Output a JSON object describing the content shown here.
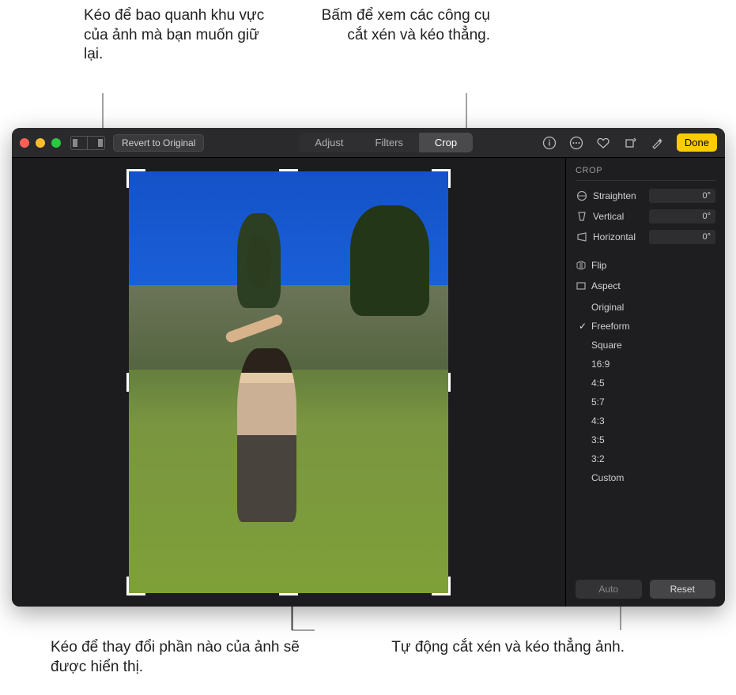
{
  "callouts": {
    "topLeft": "Kéo để bao quanh khu vực của ảnh mà bạn muốn giữ lại.",
    "topRight": "Bấm để xem các công cụ cắt xén và kéo thẳng.",
    "bottomLeft": "Kéo để thay đổi phần nào của ảnh sẽ được hiển thị.",
    "bottomRight": "Tự động cắt xén và kéo thẳng ảnh."
  },
  "toolbar": {
    "revert": "Revert to Original",
    "tabs": {
      "adjust": "Adjust",
      "filters": "Filters",
      "crop": "Crop"
    },
    "done": "Done"
  },
  "cropPanel": {
    "title": "CROP",
    "sliders": {
      "straighten": {
        "label": "Straighten",
        "value": "0°"
      },
      "vertical": {
        "label": "Vertical",
        "value": "0°"
      },
      "horizontal": {
        "label": "Horizontal",
        "value": "0°"
      }
    },
    "flip": "Flip",
    "aspect": "Aspect",
    "aspectItems": {
      "original": "Original",
      "freeform": "Freeform",
      "square": "Square",
      "r169": "16:9",
      "r45": "4:5",
      "r57": "5:7",
      "r43": "4:3",
      "r35": "3:5",
      "r32": "3:2",
      "custom": "Custom"
    },
    "auto": "Auto",
    "reset": "Reset"
  }
}
